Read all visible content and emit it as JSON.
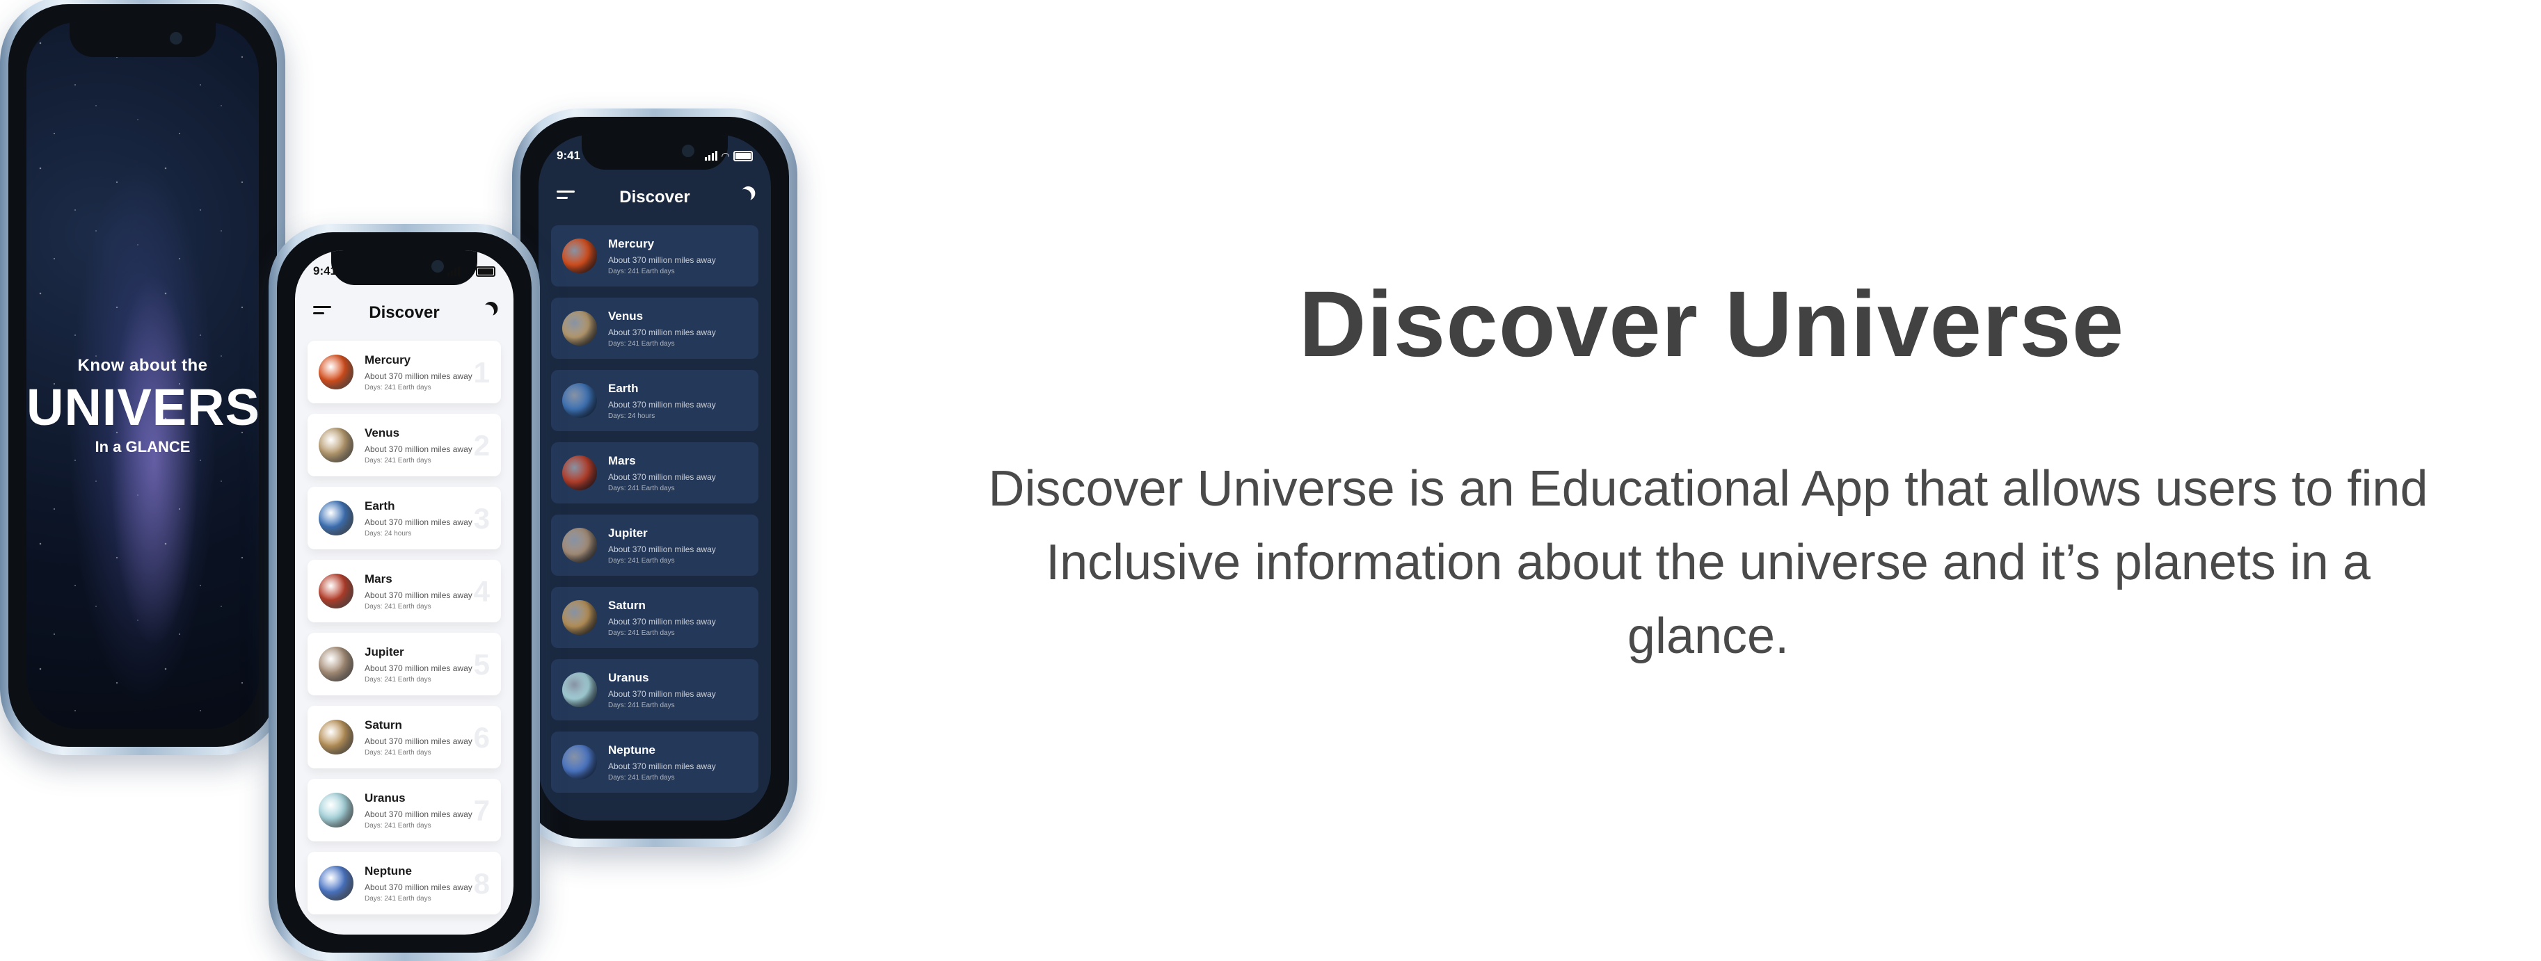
{
  "hero": {
    "title": "Discover Universe",
    "description_lines": [
      "Discover Universe is an Educational App that allows users to find",
      "Inclusive information about the universe and it’s planets in a",
      "glance."
    ]
  },
  "splash": {
    "tagline_top": "Know about the",
    "tagline_main": "UNIVERSE",
    "tagline_bottom": "In a GLANCE"
  },
  "status_bar": {
    "time": "9:41"
  },
  "app": {
    "header_title": "Discover"
  },
  "icons": {
    "menu": "hamburger-menu-icon",
    "theme": "moon-icon",
    "signal": "cellular-signal-icon",
    "wifi": "wifi-icon",
    "battery": "battery-icon"
  },
  "colors": {
    "dark_bg": "#1a2940",
    "dark_card": "#24395a",
    "light_bg": "#f4f5f8",
    "text_heading": "#424242"
  },
  "planets_light": [
    {
      "name": "Mercury",
      "distance": "About 370 million miles away",
      "days": "Days: 241 Earth days",
      "num": "1",
      "color": "#d8501e"
    },
    {
      "name": "Venus",
      "distance": "About 370 million miles away",
      "days": "Days: 241 Earth days",
      "num": "2",
      "color": "#b89c70"
    },
    {
      "name": "Earth",
      "distance": "About 370 million miles away",
      "days": "Days: 24 hours",
      "num": "3",
      "color": "#3f74b8"
    },
    {
      "name": "Mars",
      "distance": "About 370 million miles away",
      "days": "Days: 241 Earth days",
      "num": "4",
      "color": "#b8402c"
    },
    {
      "name": "Jupiter",
      "distance": "About 370 million miles away",
      "days": "Days: 241 Earth days",
      "num": "5",
      "color": "#a8907a"
    },
    {
      "name": "Saturn",
      "distance": "About 370 million miles away",
      "days": "Days: 241 Earth days",
      "num": "6",
      "color": "#b9935a"
    },
    {
      "name": "Uranus",
      "distance": "About 370 million miles away",
      "days": "Days: 241 Earth days",
      "num": "7",
      "color": "#a6d4dc"
    },
    {
      "name": "Neptune",
      "distance": "About 370 million miles away",
      "days": "Days: 241 Earth days",
      "num": "8",
      "color": "#4d78c8"
    }
  ],
  "planets_dark": [
    {
      "name": "Mercury",
      "distance": "About 370 million miles away",
      "days": "Days: 241 Earth days",
      "color": "#d8501e"
    },
    {
      "name": "Venus",
      "distance": "About 370 million miles away",
      "days": "Days: 241 Earth days",
      "color": "#b89c70"
    },
    {
      "name": "Earth",
      "distance": "About 370 million miles away",
      "days": "Days: 24 hours",
      "color": "#3f74b8"
    },
    {
      "name": "Mars",
      "distance": "About 370 million miles away",
      "days": "Days: 241 Earth days",
      "color": "#b8402c"
    },
    {
      "name": "Jupiter",
      "distance": "About 370 million miles away",
      "days": "Days: 241 Earth days",
      "color": "#a8907a"
    },
    {
      "name": "Saturn",
      "distance": "About 370 million miles away",
      "days": "Days: 241 Earth days",
      "color": "#b9935a"
    },
    {
      "name": "Uranus",
      "distance": "About 370 million miles away",
      "days": "Days: 241 Earth days",
      "color": "#a6d4dc"
    },
    {
      "name": "Neptune",
      "distance": "About 370 million miles away",
      "days": "Days: 241 Earth days",
      "color": "#4d78c8"
    }
  ]
}
